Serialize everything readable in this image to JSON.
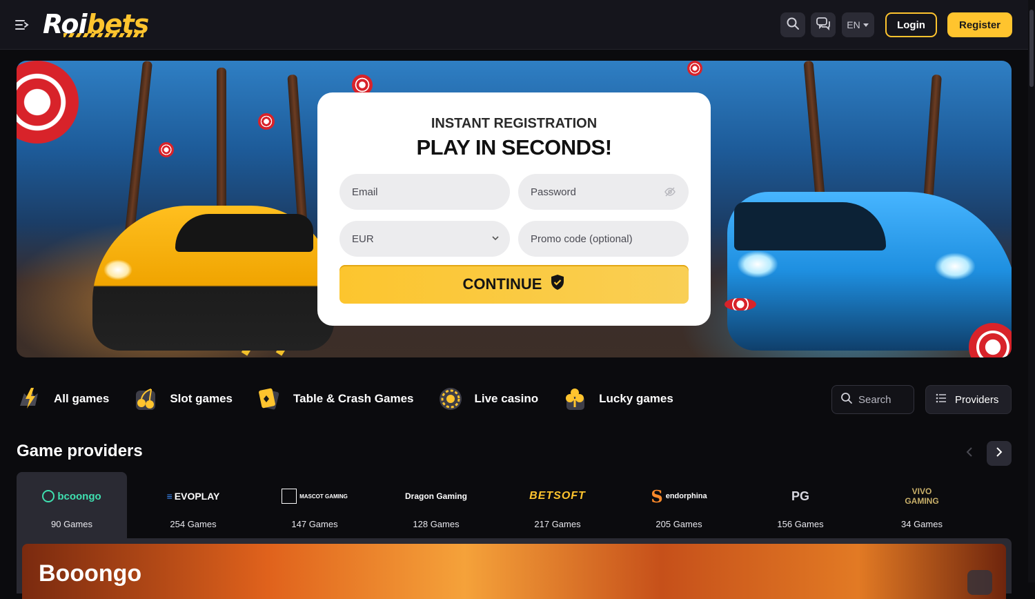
{
  "header": {
    "logo_main": "Roi",
    "logo_accent": "bets",
    "language": "EN",
    "login_label": "Login",
    "register_label": "Register",
    "brand_color": "#ffc42e"
  },
  "registration": {
    "subtitle": "INSTANT REGISTRATION",
    "title": "PLAY IN SECONDS!",
    "email_placeholder": "Email",
    "password_placeholder": "Password",
    "currency_value": "EUR",
    "promo_placeholder": "Promo code (optional)",
    "continue_label": "CONTINUE"
  },
  "categories": [
    {
      "label": "All games",
      "icon": "lightning-icon"
    },
    {
      "label": "Slot games",
      "icon": "cherries-icon"
    },
    {
      "label": "Table & Crash Games",
      "icon": "cards-icon"
    },
    {
      "label": "Live casino",
      "icon": "roulette-icon"
    },
    {
      "label": "Lucky games",
      "icon": "clover-icon"
    }
  ],
  "search": {
    "placeholder": "Search"
  },
  "providers_button": "Providers",
  "providers_section": {
    "title": "Game providers",
    "items": [
      {
        "name": "bcoongo",
        "count": "90 Games"
      },
      {
        "name": "EVOPLAY",
        "count": "254 Games"
      },
      {
        "name": "MASCOT GAMING",
        "count": "147 Games"
      },
      {
        "name": "Dragon Gaming",
        "count": "128 Games"
      },
      {
        "name": "BETSOFT",
        "count": "217 Games"
      },
      {
        "name": "endorphina",
        "count": "205 Games"
      },
      {
        "name": "PG",
        "count": "156 Games"
      },
      {
        "name": "VIVO GAMING",
        "count": "34 Games"
      }
    ]
  },
  "featured": {
    "title": "Booongo"
  }
}
